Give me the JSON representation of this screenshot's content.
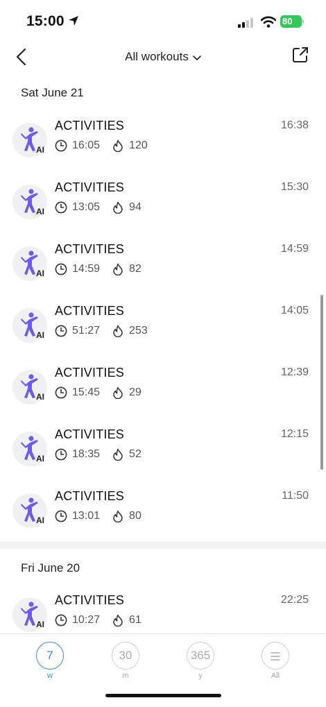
{
  "status": {
    "time": "15:00",
    "battery": "80"
  },
  "nav": {
    "title": "All workouts"
  },
  "sections": [
    {
      "date": "Sat June 21",
      "items": [
        {
          "title": "ACTIVITIES",
          "end": "16:38",
          "duration": "16:05",
          "cal": "120"
        },
        {
          "title": "ACTIVITIES",
          "end": "15:30",
          "duration": "13:05",
          "cal": "94"
        },
        {
          "title": "ACTIVITIES",
          "end": "14:59",
          "duration": "14:59",
          "cal": "82"
        },
        {
          "title": "ACTIVITIES",
          "end": "14:05",
          "duration": "51:27",
          "cal": "253"
        },
        {
          "title": "ACTIVITIES",
          "end": "12:39",
          "duration": "15:45",
          "cal": "29"
        },
        {
          "title": "ACTIVITIES",
          "end": "12:15",
          "duration": "18:35",
          "cal": "52"
        },
        {
          "title": "ACTIVITIES",
          "end": "11:50",
          "duration": "13:01",
          "cal": "80"
        }
      ]
    },
    {
      "date": "Fri June 20",
      "items": [
        {
          "title": "ACTIVITIES",
          "end": "22:25",
          "duration": "10:27",
          "cal": "61"
        }
      ]
    }
  ],
  "avatar_badge": "AI",
  "tabs": [
    {
      "value": "7",
      "label": "w",
      "active": true
    },
    {
      "value": "30",
      "label": "m",
      "active": false
    },
    {
      "value": "365",
      "label": "y",
      "active": false
    },
    {
      "value": "",
      "label": "All",
      "active": false
    }
  ],
  "colors": {
    "accent": "#3d86d8",
    "figure": "#6c5ce7",
    "battery": "#34c759"
  },
  "icons": [
    "location-arrow-icon",
    "signal-icon",
    "wifi-icon",
    "battery-icon",
    "back-chevron-icon",
    "chevron-down-icon",
    "share-icon",
    "activity-figure-icon",
    "clock-icon",
    "flame-icon",
    "menu-lines-icon"
  ]
}
